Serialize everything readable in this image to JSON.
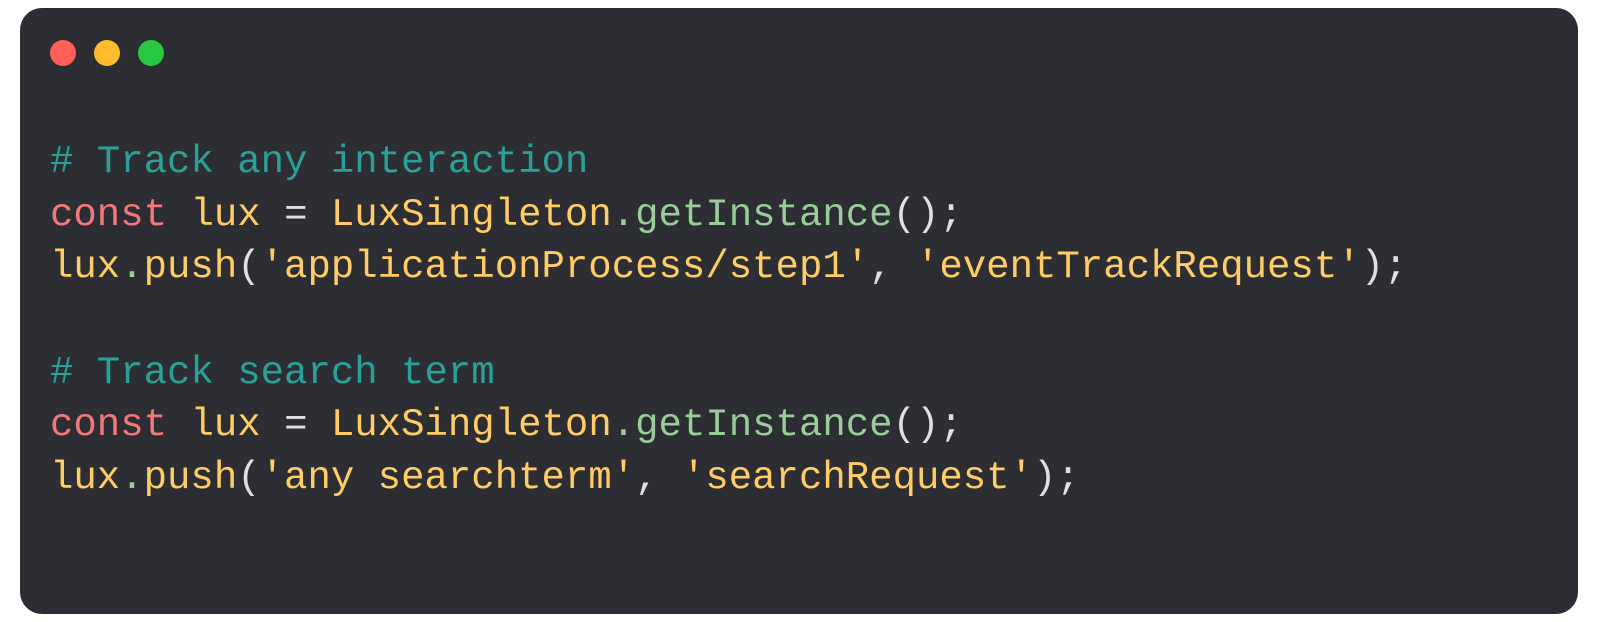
{
  "traffic_lights": {
    "red": "#ff5f57",
    "yellow": "#febc2e",
    "green": "#28c940"
  },
  "code": {
    "lines": [
      {
        "tokens": [
          {
            "cls": "tok-comment",
            "t": "# Track any interaction"
          }
        ]
      },
      {
        "tokens": [
          {
            "cls": "tok-keyword",
            "t": "const"
          },
          {
            "cls": "tok-default",
            "t": " "
          },
          {
            "cls": "tok-ident1",
            "t": "lux"
          },
          {
            "cls": "tok-default",
            "t": " "
          },
          {
            "cls": "tok-punct",
            "t": "="
          },
          {
            "cls": "tok-default",
            "t": " "
          },
          {
            "cls": "tok-ident1",
            "t": "LuxSingleton"
          },
          {
            "cls": "tok-dot",
            "t": "."
          },
          {
            "cls": "tok-ident2",
            "t": "getInstance"
          },
          {
            "cls": "tok-punct",
            "t": "();"
          }
        ]
      },
      {
        "tokens": [
          {
            "cls": "tok-ident1",
            "t": "lux"
          },
          {
            "cls": "tok-dot",
            "t": "."
          },
          {
            "cls": "tok-ident1",
            "t": "push"
          },
          {
            "cls": "tok-punct",
            "t": "("
          },
          {
            "cls": "tok-string",
            "t": "'applicationProcess/step1'"
          },
          {
            "cls": "tok-punct",
            "t": ", "
          },
          {
            "cls": "tok-string",
            "t": "'eventTrackRequest'"
          },
          {
            "cls": "tok-punct",
            "t": ");"
          }
        ]
      },
      {
        "tokens": []
      },
      {
        "tokens": [
          {
            "cls": "tok-comment",
            "t": "# Track search term"
          }
        ]
      },
      {
        "tokens": [
          {
            "cls": "tok-keyword",
            "t": "const"
          },
          {
            "cls": "tok-default",
            "t": " "
          },
          {
            "cls": "tok-ident1",
            "t": "lux"
          },
          {
            "cls": "tok-default",
            "t": " "
          },
          {
            "cls": "tok-punct",
            "t": "="
          },
          {
            "cls": "tok-default",
            "t": " "
          },
          {
            "cls": "tok-ident1",
            "t": "LuxSingleton"
          },
          {
            "cls": "tok-dot",
            "t": "."
          },
          {
            "cls": "tok-ident2",
            "t": "getInstance"
          },
          {
            "cls": "tok-punct",
            "t": "();"
          }
        ]
      },
      {
        "tokens": [
          {
            "cls": "tok-ident1",
            "t": "lux"
          },
          {
            "cls": "tok-dot",
            "t": "."
          },
          {
            "cls": "tok-ident1",
            "t": "push"
          },
          {
            "cls": "tok-punct",
            "t": "("
          },
          {
            "cls": "tok-string",
            "t": "'any searchterm'"
          },
          {
            "cls": "tok-punct",
            "t": ", "
          },
          {
            "cls": "tok-string",
            "t": "'searchRequest'"
          },
          {
            "cls": "tok-punct",
            "t": ");"
          }
        ]
      }
    ]
  }
}
